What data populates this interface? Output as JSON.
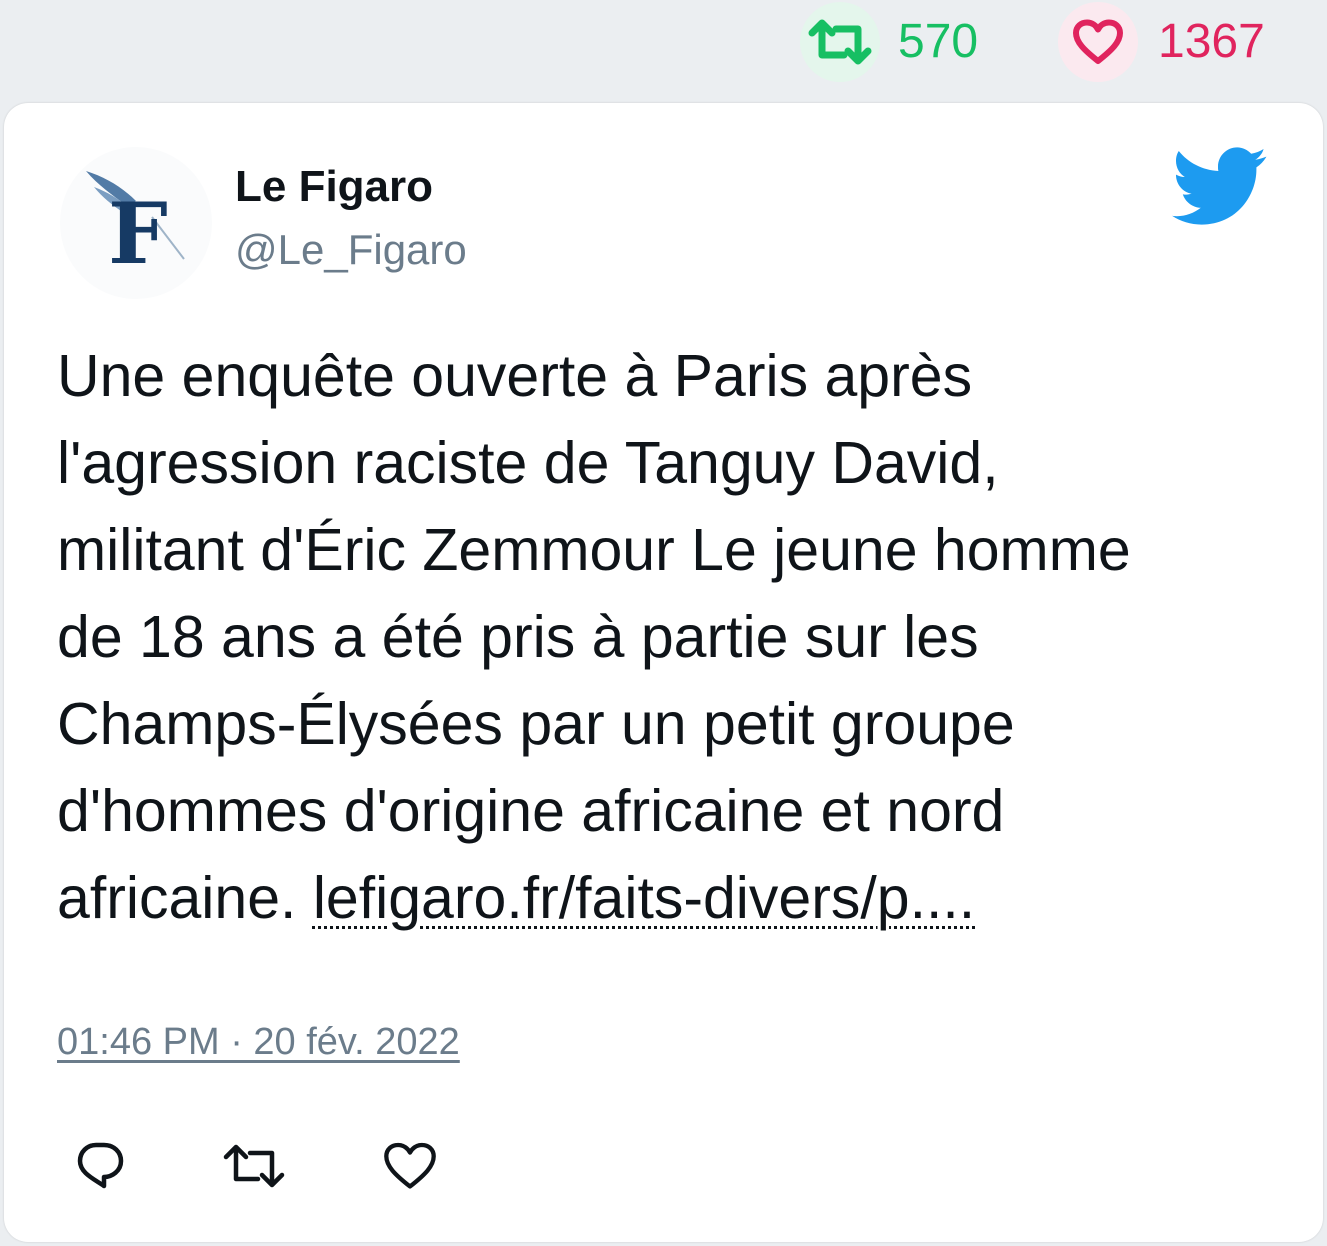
{
  "top_stats": {
    "retweets": "570",
    "likes": "1367",
    "retweet_color": "#17bf63",
    "like_color": "#e0245e"
  },
  "tweet": {
    "author_name": "Le Figaro",
    "author_handle": "@Le_Figaro",
    "avatar_letter": "F",
    "text_lines": [
      "Une enquête ouverte à Paris après",
      "l'agression raciste de Tanguy David,",
      "militant d'Éric Zemmour Le jeune homme",
      "de 18 ans a été pris à partie sur les",
      "Champs-Élysées par un petit groupe",
      "d'hommes d'origine africaine et nord"
    ],
    "last_line_text": "africaine.",
    "link_text": "lefigaro.fr/faits-divers/p....",
    "timestamp": "01:46 PM · 20 fév. 2022"
  },
  "icons": {
    "brand": "twitter-bird-icon",
    "actions": [
      "reply-icon",
      "retweet-icon",
      "like-icon"
    ],
    "brand_color": "#1d9bf0",
    "avatar_color": "#163a64"
  }
}
